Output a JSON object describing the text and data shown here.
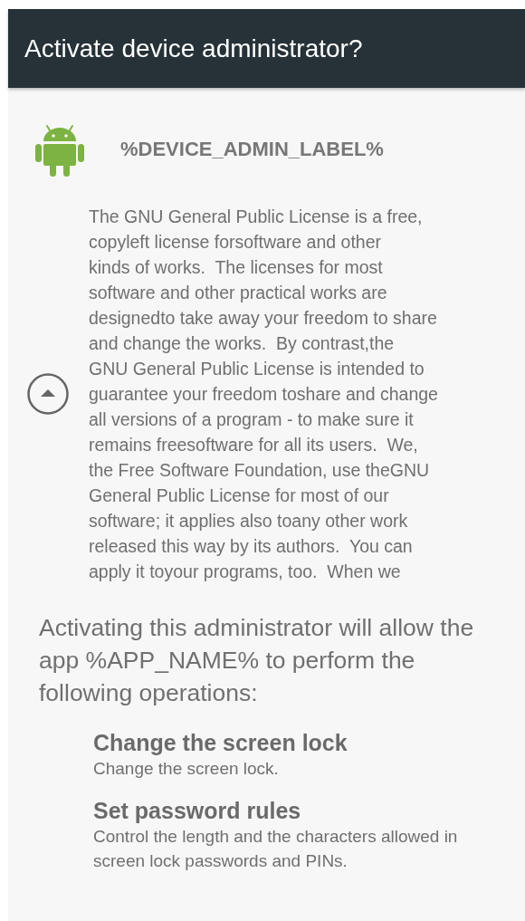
{
  "header": {
    "title": "Activate device administrator?"
  },
  "admin": {
    "label": "%DEVICE_ADMIN_LABEL%",
    "description": "The GNU General Public License is a free,\ncopyleft license forsoftware and other\nkinds of works.  The licenses for most\nsoftware and other practical works are\ndesignedto take away your freedom to share\nand change the works.  By contrast,the\nGNU General Public License is intended to\nguarantee your freedom toshare and change\nall versions of a program - to make sure it\nremains freesoftware for all its users.  We,\nthe Free Software Foundation, use theGNU\nGeneral Public License for most of our\nsoftware; it applies also toany other work\nreleased this way by its authors.  You can\napply it toyour programs, too.  When we"
  },
  "intro": "Activating this administrator will allow the app %APP_NAME% to perform the following operations:",
  "policies": [
    {
      "title": "Change the screen lock",
      "description": "Change the screen lock."
    },
    {
      "title": "Set password rules",
      "description": "Control the length and the characters allowed in screen lock passwords and PINs."
    }
  ]
}
